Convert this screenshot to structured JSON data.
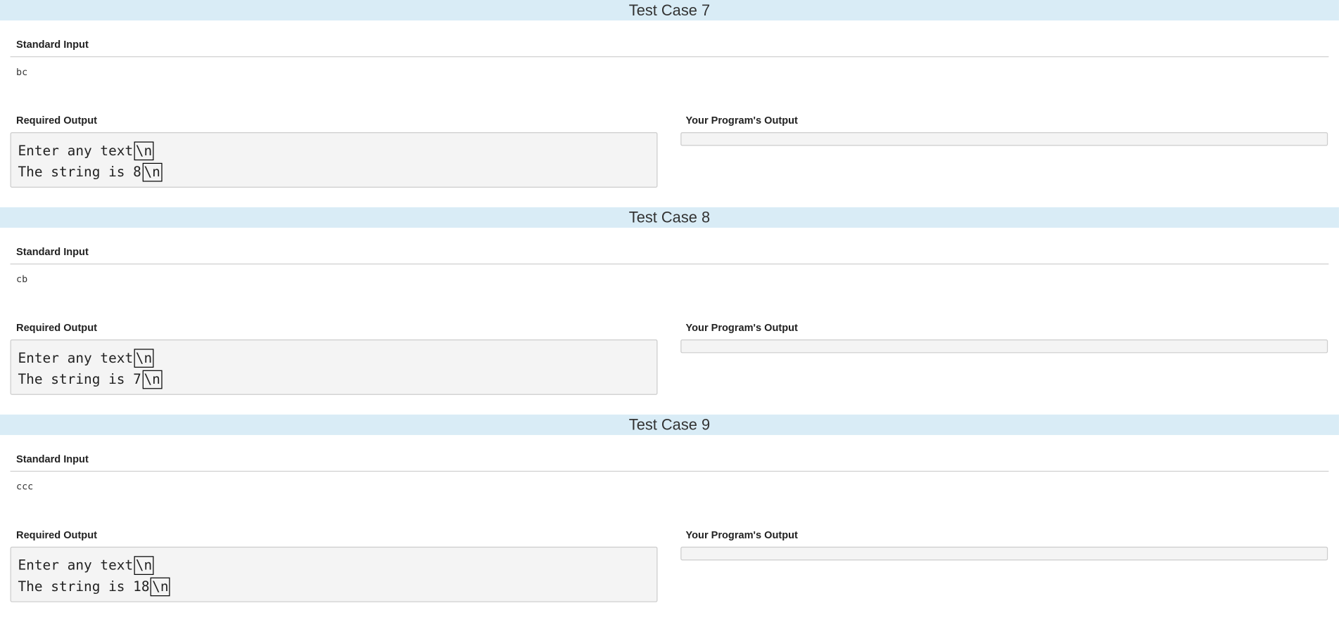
{
  "test_cases": [
    {
      "title": "Test Case 7",
      "standard_input_label": "Standard Input",
      "standard_input": "bc",
      "required_output_label": "Required Output",
      "required_output_lines": [
        "Enter any text",
        "The string is 8"
      ],
      "newline_marker": "\\n",
      "your_output_label": "Your Program's Output",
      "your_output": ""
    },
    {
      "title": "Test Case 8",
      "standard_input_label": "Standard Input",
      "standard_input": "cb",
      "required_output_label": "Required Output",
      "required_output_lines": [
        "Enter any text",
        "The string is 7"
      ],
      "newline_marker": "\\n",
      "your_output_label": "Your Program's Output",
      "your_output": ""
    },
    {
      "title": "Test Case 9",
      "standard_input_label": "Standard Input",
      "standard_input": "ccc",
      "required_output_label": "Required Output",
      "required_output_lines": [
        "Enter any text",
        "The string is 18"
      ],
      "newline_marker": "\\n",
      "your_output_label": "Your Program's Output",
      "your_output": ""
    }
  ],
  "colors": {
    "header_bg": "#d9ecf6",
    "output_box_bg": "#f4f4f4"
  }
}
